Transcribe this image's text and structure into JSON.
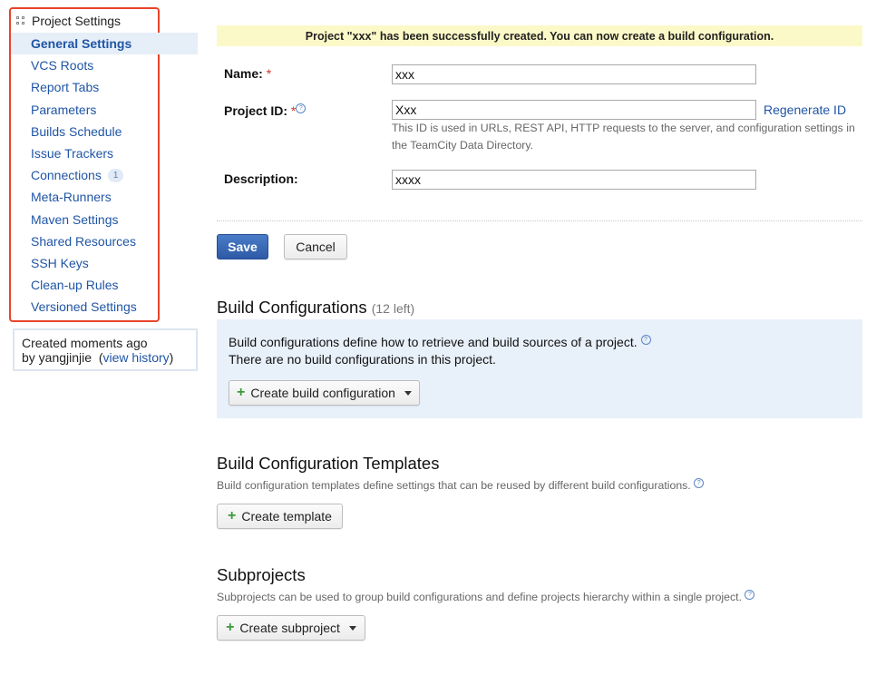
{
  "sidebar": {
    "header": "Project Settings",
    "items": [
      {
        "label": "General Settings",
        "active": true
      },
      {
        "label": "VCS Roots"
      },
      {
        "label": "Report Tabs"
      },
      {
        "label": "Parameters"
      },
      {
        "label": "Builds Schedule"
      },
      {
        "label": "Issue Trackers"
      },
      {
        "label": "Connections",
        "badge": "1"
      },
      {
        "label": "Meta-Runners"
      },
      {
        "label": "Maven Settings"
      },
      {
        "label": "Shared Resources"
      },
      {
        "label": "SSH Keys"
      },
      {
        "label": "Clean-up Rules"
      },
      {
        "label": "Versioned Settings"
      }
    ],
    "history": {
      "line1": "Created moments ago",
      "by": "by yangjinjie",
      "link": "view history"
    }
  },
  "banner": "Project \"xxx\" has been successfully created. You can now create a build configuration.",
  "form": {
    "name_label": "Name:",
    "name_value": "xxx",
    "id_label": "Project ID:",
    "id_value": "Xxx",
    "regenerate": "Regenerate ID",
    "id_hint": "This ID is used in URLs, REST API, HTTP requests to the server, and configuration settings in the TeamCity Data Directory.",
    "description_label": "Description:",
    "description_value": "xxxx",
    "required_mark": "*",
    "save": "Save",
    "cancel": "Cancel"
  },
  "build_configs": {
    "title": "Build Configurations",
    "left": "(12 left)",
    "desc": "Build configurations define how to retrieve and build sources of a project.",
    "empty": "There are no build configurations in this project.",
    "button": "Create build configuration"
  },
  "templates": {
    "title": "Build Configuration Templates",
    "desc": "Build configuration templates define settings that can be reused by different build configurations.",
    "button": "Create template"
  },
  "subprojects": {
    "title": "Subprojects",
    "desc": "Subprojects can be used to group build configurations and define projects hierarchy within a single project.",
    "button": "Create subproject"
  },
  "icons": {
    "help": "question-mark-circle-icon",
    "plus": "plus-icon",
    "caret": "dropdown-caret-icon",
    "grid": "grid-icon"
  },
  "colors": {
    "link": "#1f55a5",
    "highlight_border": "#e8442a",
    "banner_bg": "#fcf9c8",
    "panel_bg": "#e8f0fa",
    "primary_button": "#2d5aa6"
  }
}
